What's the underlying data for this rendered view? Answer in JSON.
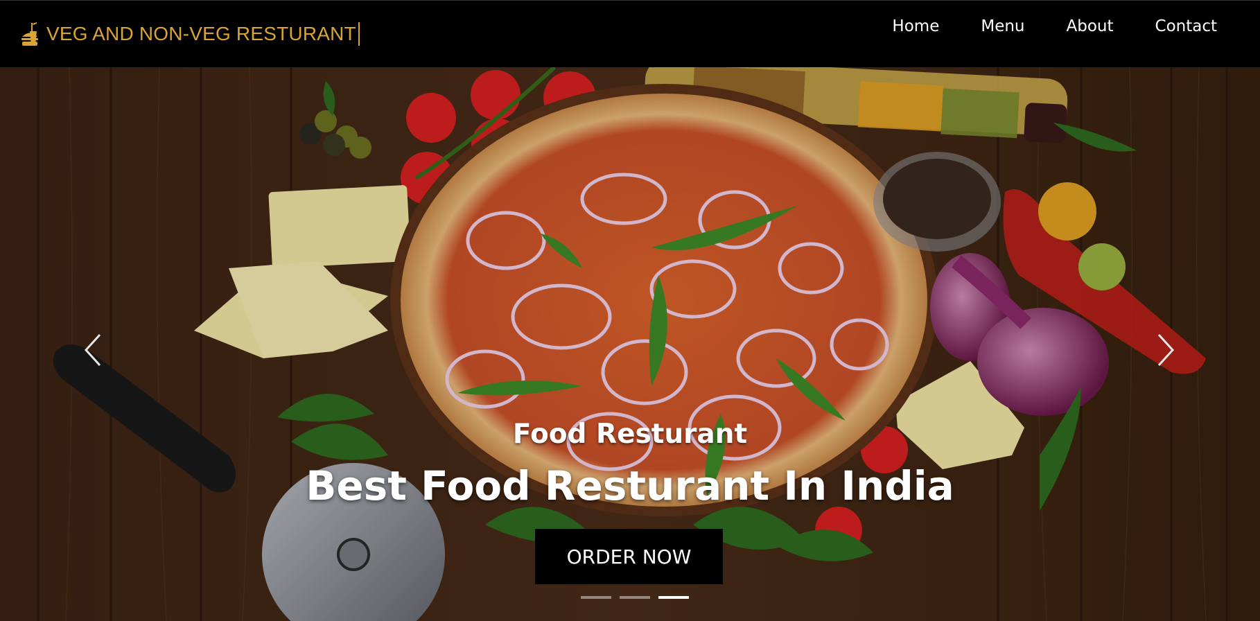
{
  "navbar": {
    "brand": "VEG AND NON-VEG RESTURANT",
    "brand_icon": "burger-drink-icon",
    "links": [
      "Home",
      "Menu",
      "About",
      "Contact"
    ]
  },
  "hero": {
    "subtitle": "Food Resturant",
    "title": "Best Food Resturant In India",
    "button": "ORDER NOW",
    "prev_icon": "chevron-left-icon",
    "next_icon": "chevron-right-icon",
    "slides": 3,
    "active_slide": 3
  },
  "colors": {
    "brand": "#d9a336",
    "navbar_bg": "#000000",
    "button_bg": "#000000"
  }
}
